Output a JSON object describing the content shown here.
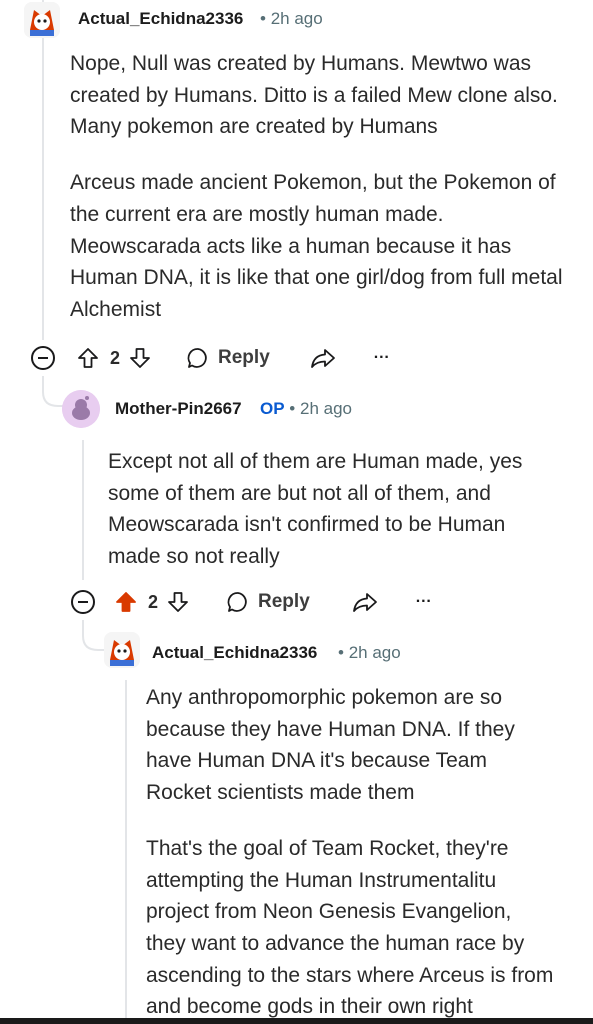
{
  "comments": [
    {
      "username": "Actual_Echidna2336",
      "time": "2h ago",
      "body": [
        "Nope, Null was created by Humans. Mewtwo was created by Humans. Ditto is a failed Mew clone also. Many pokemon are created by Humans",
        "Arceus made ancient Pokemon, but the Pokemon of the current era are mostly human made. Meowscarada acts like a human because it has Human DNA, it is like that one girl/dog from full metal Alchemist"
      ],
      "votes": "2",
      "upvoted": false,
      "reply_label": "Reply",
      "more_label": "···"
    },
    {
      "username": "Mother-Pin2667",
      "op_badge": "OP",
      "time": "2h ago",
      "body": [
        "Except not all of them are Human made, yes some of them are but not all of them, and Meowscarada isn't confirmed to be Human made so not really"
      ],
      "votes": "2",
      "upvoted": true,
      "reply_label": "Reply",
      "more_label": "···"
    },
    {
      "username": "Actual_Echidna2336",
      "time": "2h ago",
      "body": [
        "Any anthropomorphic pokemon are so because they have Human DNA. If they have Human DNA it's because Team Rocket scientists made them",
        "That's the goal of Team Rocket, they're attempting the Human Instrumentalitu project from Neon Genesis Evangelion, they want to advance the human race by ascending to the stars where Arceus is from and become gods in their own right"
      ]
    }
  ],
  "separator": "•",
  "colors": {
    "upvote_active": "#d93a00",
    "op_badge": "#0a5bd1",
    "thread_line": "#e3e5e8",
    "meta_text": "#576f76"
  },
  "icons": {
    "collapse": "collapse-minus-icon",
    "upvote": "upvote-arrow-icon",
    "downvote": "downvote-arrow-icon",
    "reply": "speech-bubble-icon",
    "share": "share-arrow-icon",
    "more": "more-dots-icon"
  }
}
